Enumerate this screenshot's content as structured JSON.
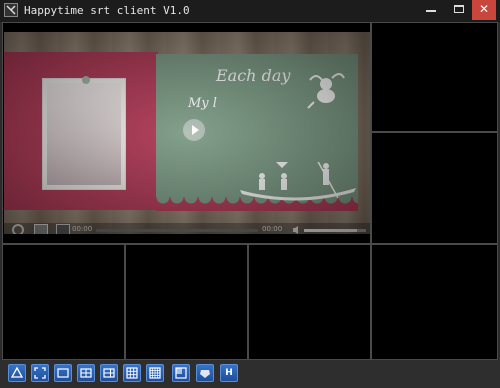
{
  "window": {
    "title": "Happytime srt client V1.0",
    "close_glyph": "✕"
  },
  "video": {
    "caption_title": "Each day",
    "caption_sub": "My l",
    "time_current": "00:00",
    "time_total": "00:00",
    "progress": 0.0,
    "volume": 0.85
  },
  "toolbar": {
    "buttons": [
      {
        "name": "main-menu-icon"
      },
      {
        "name": "fullscreen-icon"
      },
      {
        "name": "layout-1-icon"
      },
      {
        "name": "layout-4-icon"
      },
      {
        "name": "layout-6-icon"
      },
      {
        "name": "layout-9-icon"
      },
      {
        "name": "layout-16-icon"
      },
      {
        "name": "layout-custom-icon"
      },
      {
        "name": "ptz-icon"
      },
      {
        "name": "hardware-decode-button",
        "label": "H"
      }
    ]
  },
  "colors": {
    "toolbar_button": "#2a63b8",
    "close_button": "#c9463d"
  }
}
